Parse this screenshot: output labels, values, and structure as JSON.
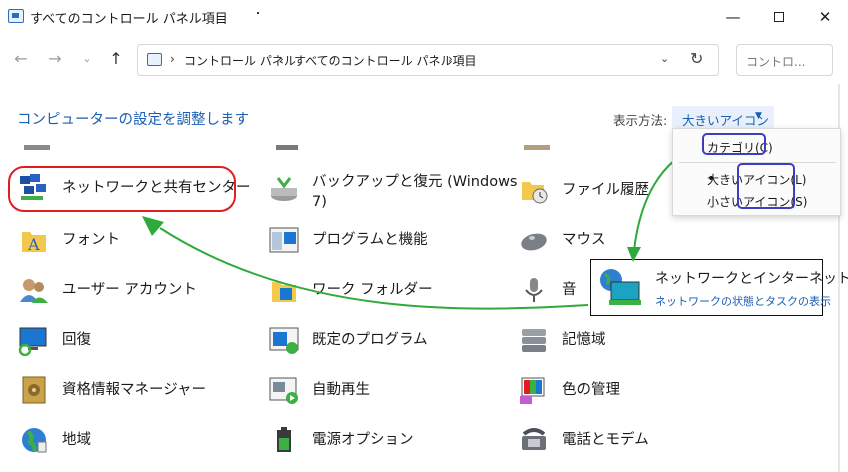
{
  "window": {
    "title": "すべてのコントロール パネル項目",
    "min_glyph": "—",
    "close_glyph": "✕"
  },
  "nav": {
    "back_glyph": "←",
    "forward_glyph": "→",
    "recent_glyph": "⌄",
    "up_glyph": "↑",
    "breadcrumbs": [
      "コントロール パネル",
      "すべてのコントロール パネル項目"
    ],
    "separator": "›",
    "dropdown_glyph": "⌄",
    "refresh_glyph": "↻",
    "search_placeholder": "コントロ..."
  },
  "heading": "コンピューターの設定を調整します",
  "view": {
    "label": "表示方法:",
    "current": "大きいアイコン",
    "caret": "▼"
  },
  "items": {
    "col1": [
      "ネットワークと共有センター",
      "フォント",
      "ユーザー アカウント",
      "回復",
      "資格情報マネージャー",
      "地域"
    ],
    "col2": [
      "バックアップと復元 (Windows",
      "7)",
      "プログラムと機能",
      "ワーク フォルダー",
      "既定のプログラム",
      "自動再生",
      "電源オプション"
    ],
    "col3": [
      "ファイル履歴",
      "マウス",
      "音",
      "記憶域",
      "色の管理",
      "電話とモデム"
    ]
  },
  "menu": {
    "items": [
      "カテゴリ(C)",
      "大きいアイコン(L)",
      "小さいアイコン(S)"
    ],
    "selected_dot": "•"
  },
  "popup": {
    "title": "ネットワークとインターネット",
    "subtitle": "ネットワークの状態とタスクの表示"
  },
  "colors": {
    "link_blue": "#1a5fb4",
    "highlight_red": "#e01e22",
    "annotation_blue": "#3b3fbf",
    "arrow_green": "#2eaa3c"
  }
}
